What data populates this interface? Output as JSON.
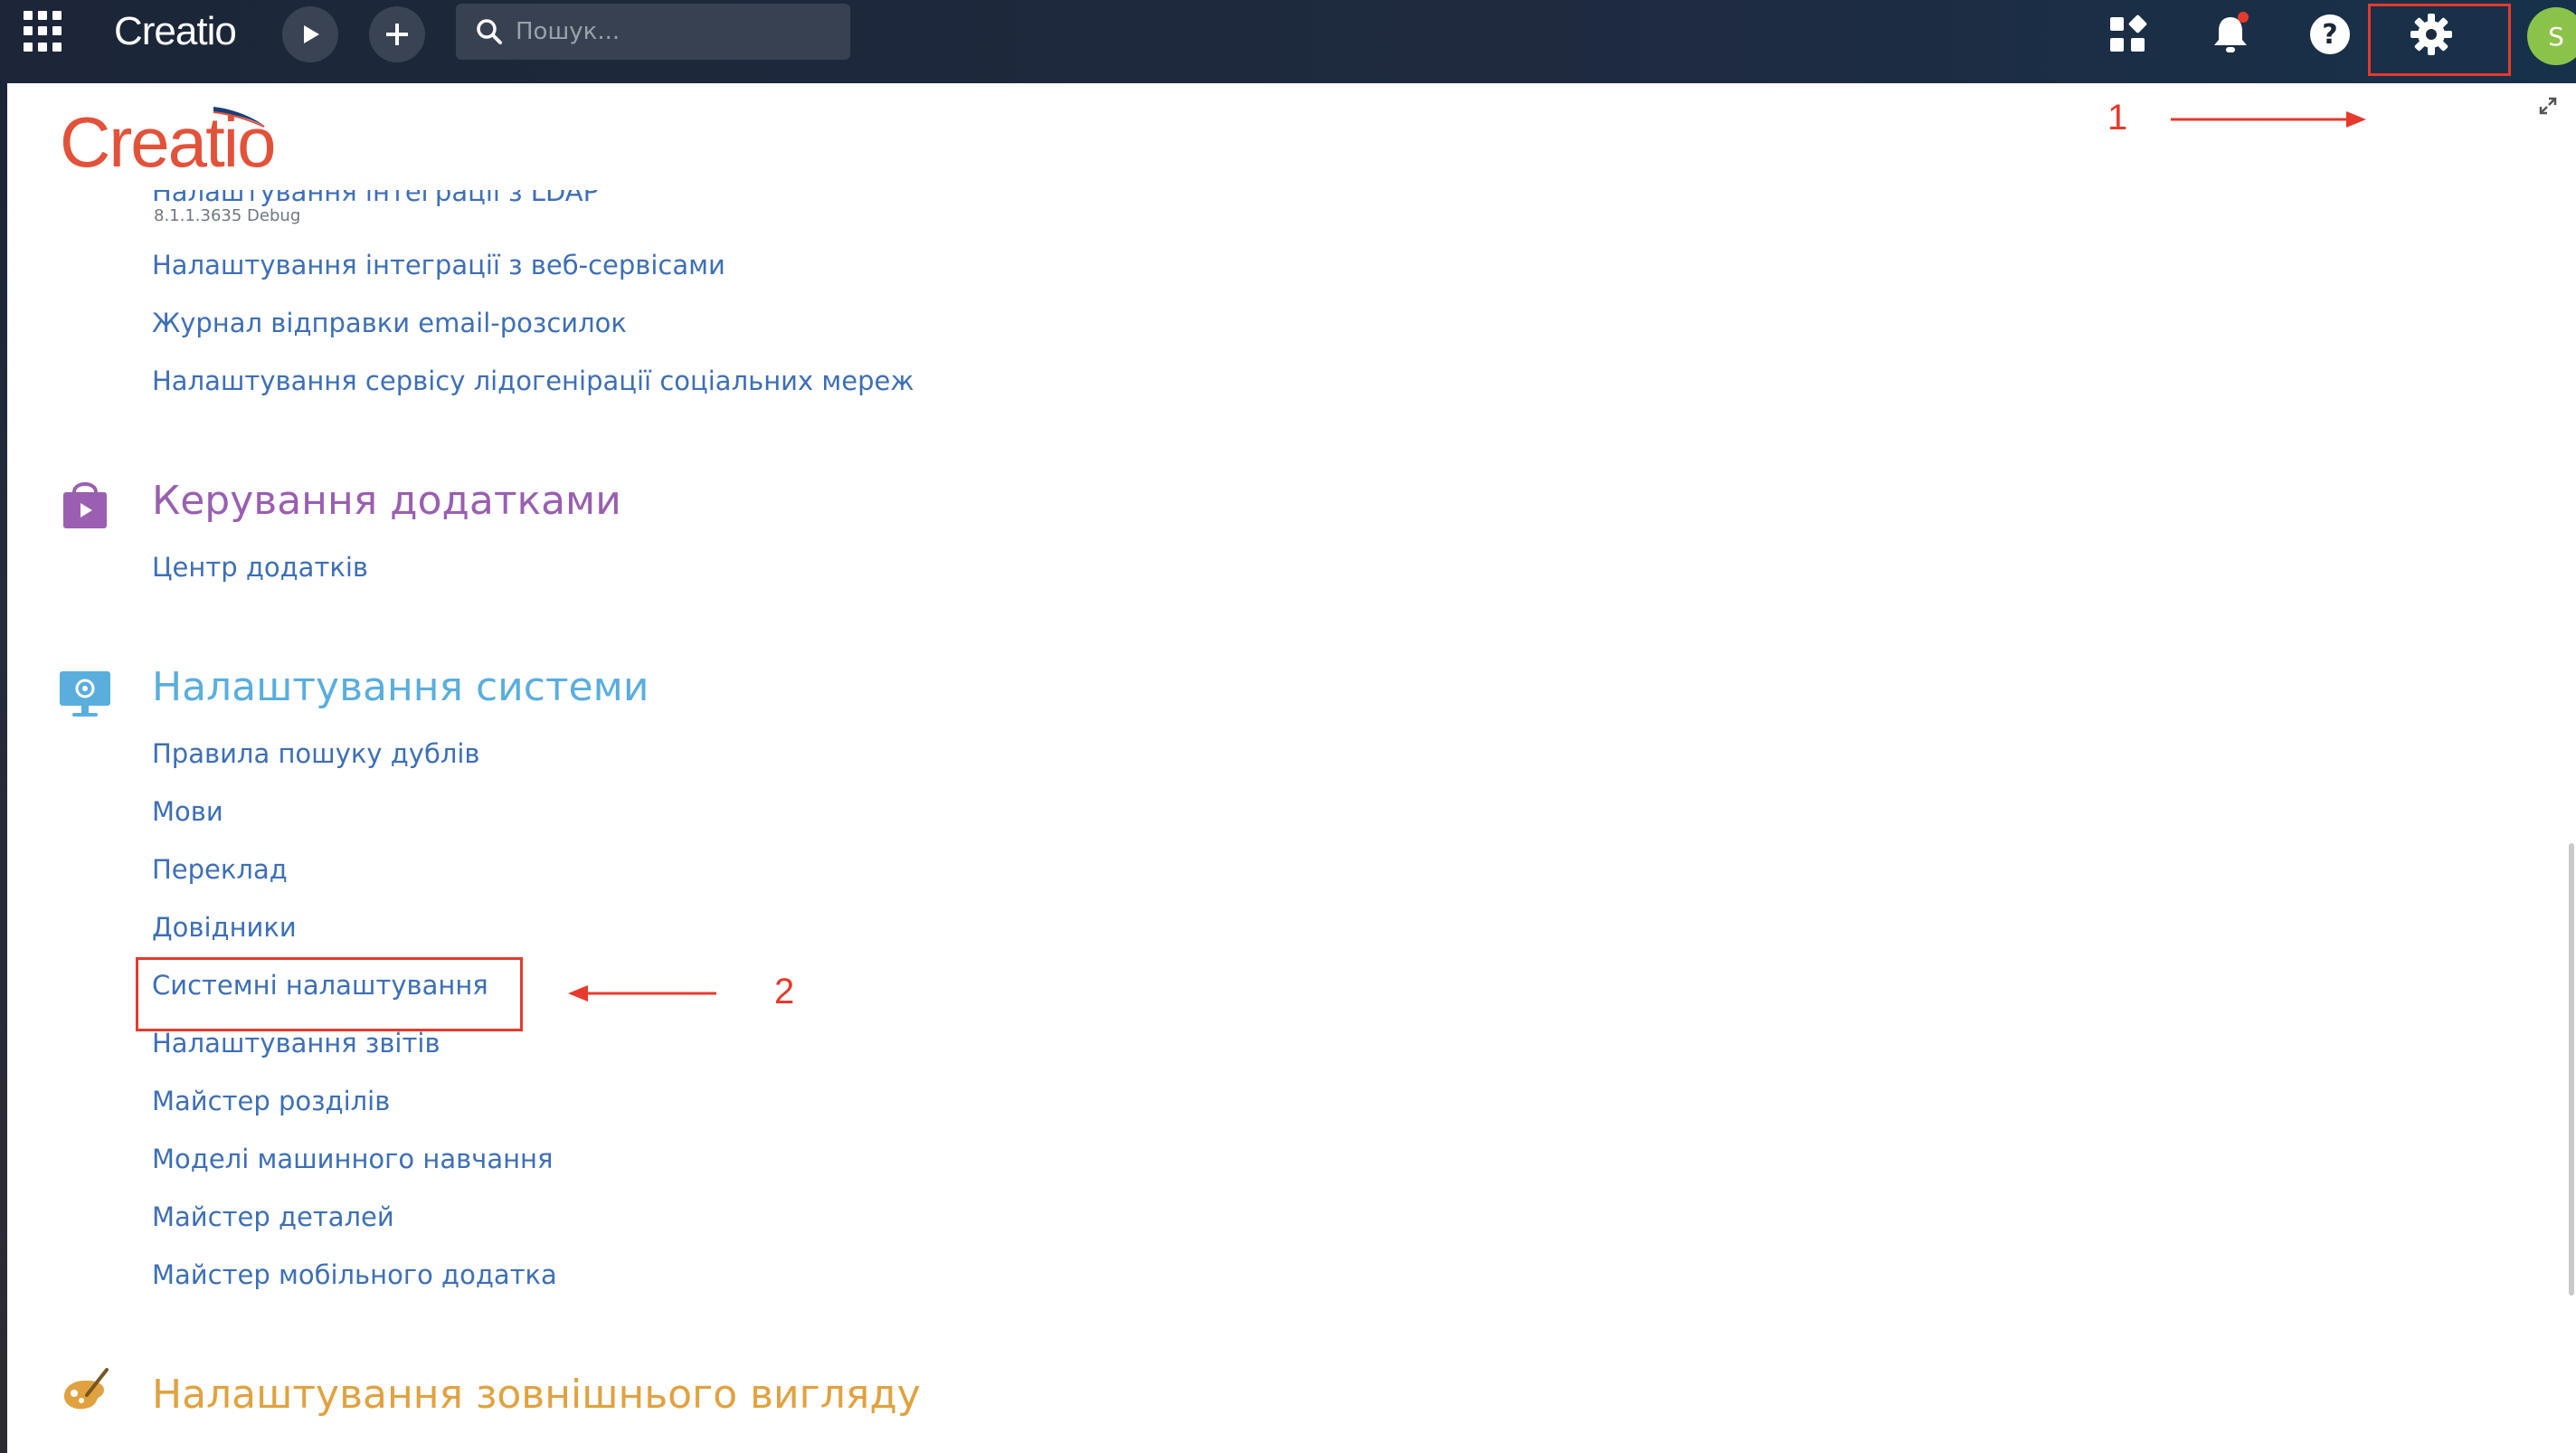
{
  "topbar": {
    "brand": "Creatio",
    "search_placeholder": "Пошук...",
    "avatar_initial": "S"
  },
  "panel": {
    "logo_word": "Creatio",
    "version": "8.1.1.3635 Debug",
    "cut_link": "Налаштування інтеграції з LDAP",
    "integration_links": [
      "Налаштування інтеграції з веб-сервісами",
      "Журнал відправки email-розсилок",
      "Налаштування сервісу лідогенірації соціальних мереж"
    ],
    "apps_section": {
      "title": "Керування додатками",
      "color": "#9a5fb0",
      "links": [
        "Центр додатків"
      ]
    },
    "system_section": {
      "title": "Налаштування системи",
      "color": "#5aaede",
      "links": [
        "Правила пошуку дублів",
        "Мови",
        "Переклад",
        "Довідники",
        "Системні налаштування",
        "Налаштування звітів",
        "Майстер розділів",
        "Моделі машинного навчання",
        "Майстер деталей",
        "Майстер мобільного додатка"
      ]
    },
    "appearance_section": {
      "title": "Налаштування зовнішнього вигляду",
      "color": "#e0a240"
    }
  },
  "annotations": {
    "one": "1",
    "two": "2",
    "color": "#e53a2c"
  },
  "colors": {
    "link": "#3d6fb6",
    "topbar": "#1c2638"
  }
}
